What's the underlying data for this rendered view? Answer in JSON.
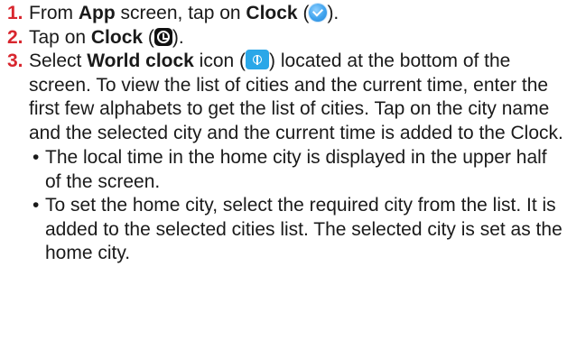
{
  "steps": [
    {
      "number": "1.",
      "text_a": "From ",
      "bold_a": "App",
      "text_b": " screen, tap on ",
      "bold_b": "Clock",
      "text_c": " (",
      "icon": "clock-app-icon",
      "text_d": ")."
    },
    {
      "number": "2.",
      "text_a": "Tap on ",
      "bold_a": "Clock",
      "text_b": " (",
      "icon": "clock-tab-icon",
      "text_c": ")."
    },
    {
      "number": "3.",
      "text_a": "Select ",
      "bold_a": "World clock",
      "text_b": " icon (",
      "icon": "world-clock-icon",
      "text_c": ") located at the bottom of the screen. To view the list of cities and the current time, enter the first few alphabets to get the list of cities. Tap on the city name and the selected city and the current time is added to the Clock.",
      "bullets": [
        "The local time in the home city is displayed in the upper half of the screen.",
        "To set the home city, select the required city from the list. It is added to the selected cities list. The selected city is set as the home city."
      ]
    }
  ],
  "colors": {
    "step_number": "#d8262e",
    "text": "#1a1a1a",
    "icon_blue": "#2aa7e8"
  }
}
